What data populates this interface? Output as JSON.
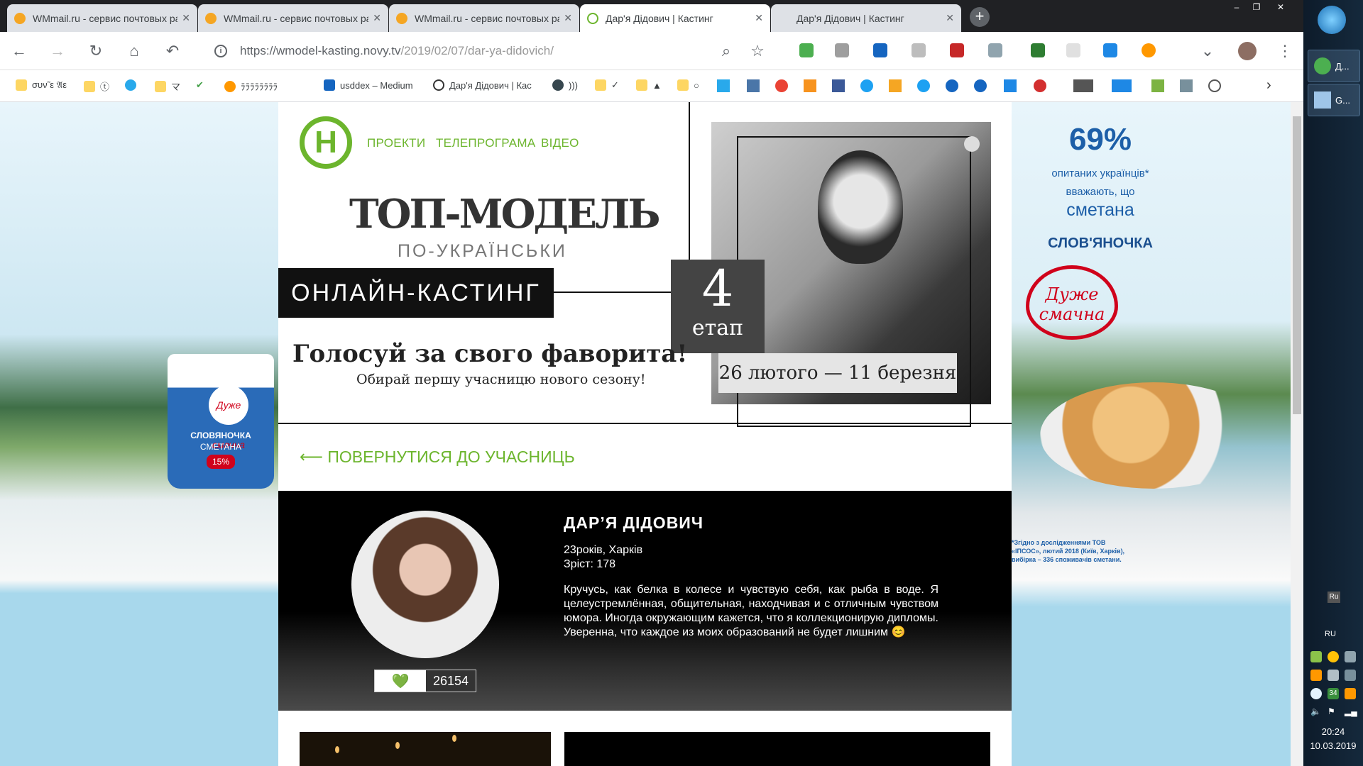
{
  "tabs": [
    {
      "title": "WMmail.ru - сервис почтовых расс",
      "active": false
    },
    {
      "title": "WMmail.ru - сервис почтовых расс",
      "active": false
    },
    {
      "title": "WMmail.ru - сервис почтовых расс",
      "active": false
    },
    {
      "title": "Дар'я Дідович | Кастинг",
      "active": true
    },
    {
      "title": "Дар'я Дідович | Кастинг",
      "active": false
    }
  ],
  "window": {
    "minimize": "–",
    "restore": "❐",
    "close": "✕",
    "new_tab": "+"
  },
  "toolbar": {
    "url_base": "https://wmodel-kasting.novy.tv",
    "url_path": "/2019/02/07/dar-ya-didovich/",
    "info_glyph": "i"
  },
  "bookmarks": [
    {
      "label": "συν̃ ε 𝔄ε"
    },
    {
      "label": "ⓣ"
    },
    {
      "label": ""
    },
    {
      "label": "マ"
    },
    {
      "label": "✔"
    },
    {
      "label": "ﾗﾗﾗﾗﾗﾗﾗﾗ"
    },
    {
      "label": "usddex – Medium"
    },
    {
      "label": "Дар'я Дідович | Кас"
    },
    {
      "label": ")))"
    },
    {
      "label": "✓"
    },
    {
      "label": "▲"
    },
    {
      "label": "○"
    }
  ],
  "site": {
    "logo_letter": "Н",
    "nav": [
      "ПРОЕКТИ",
      "ТЕЛЕПРОГРАМА",
      "ВІДЕО"
    ],
    "show_title": "ТОП-МОДЕЛЬ",
    "show_subtitle": "ПО-УКРАЇНСЬКИ",
    "casting_label": "ОНЛАЙН-КАСТИНГ",
    "stage_number": "4",
    "stage_label": "етап",
    "dates": "26 лютого — 11 березня",
    "vote_title": "Голосуй за свого фаворита!",
    "vote_subtitle": "Обирай першу учасницю нового сезону!",
    "back_link": "⟵ ПОВЕРНУТИСЯ ДО УЧАСНИЦЬ"
  },
  "profile": {
    "name": "ДАР’Я ДІДОВИЧ",
    "age_city": "23років, Харків",
    "height": "Зріст: 178",
    "bio": "Кручусь, как белка в колесе и чувствую себя, как рыба в воде. Я целеустремлённая, общительная, находчивая и с отличным чувством юмора. Иногда окружающим кажется, что я коллекционирую дипломы. Уверенна, что каждое из моих образований не будет лишним 😊",
    "likes": "26154",
    "heart": "💚"
  },
  "ad_left": {
    "brand": "СЛОВЯНОЧКА",
    "product": "СМЕТАНА",
    "fat": "15%",
    "tagline": "Дуже смачна"
  },
  "ad_right": {
    "percent": "69%",
    "line1": "опитаних українців*",
    "line2": "вважають, що",
    "line3": "сметана",
    "brand": "СЛОВ'ЯНОЧКА",
    "tagline": "Дуже смачна",
    "footnote": "*Згідно з дослідженнями ТОВ «ІПСОС», лютий 2018 (Київ, Харків), вибірка – 336 споживачів сметани."
  },
  "taskbar": {
    "apps": [
      "Д...",
      "G..."
    ],
    "lang": "RU",
    "lang_small": "Ru",
    "badge": "34",
    "time": "20:24",
    "date": "10.03.2019"
  }
}
